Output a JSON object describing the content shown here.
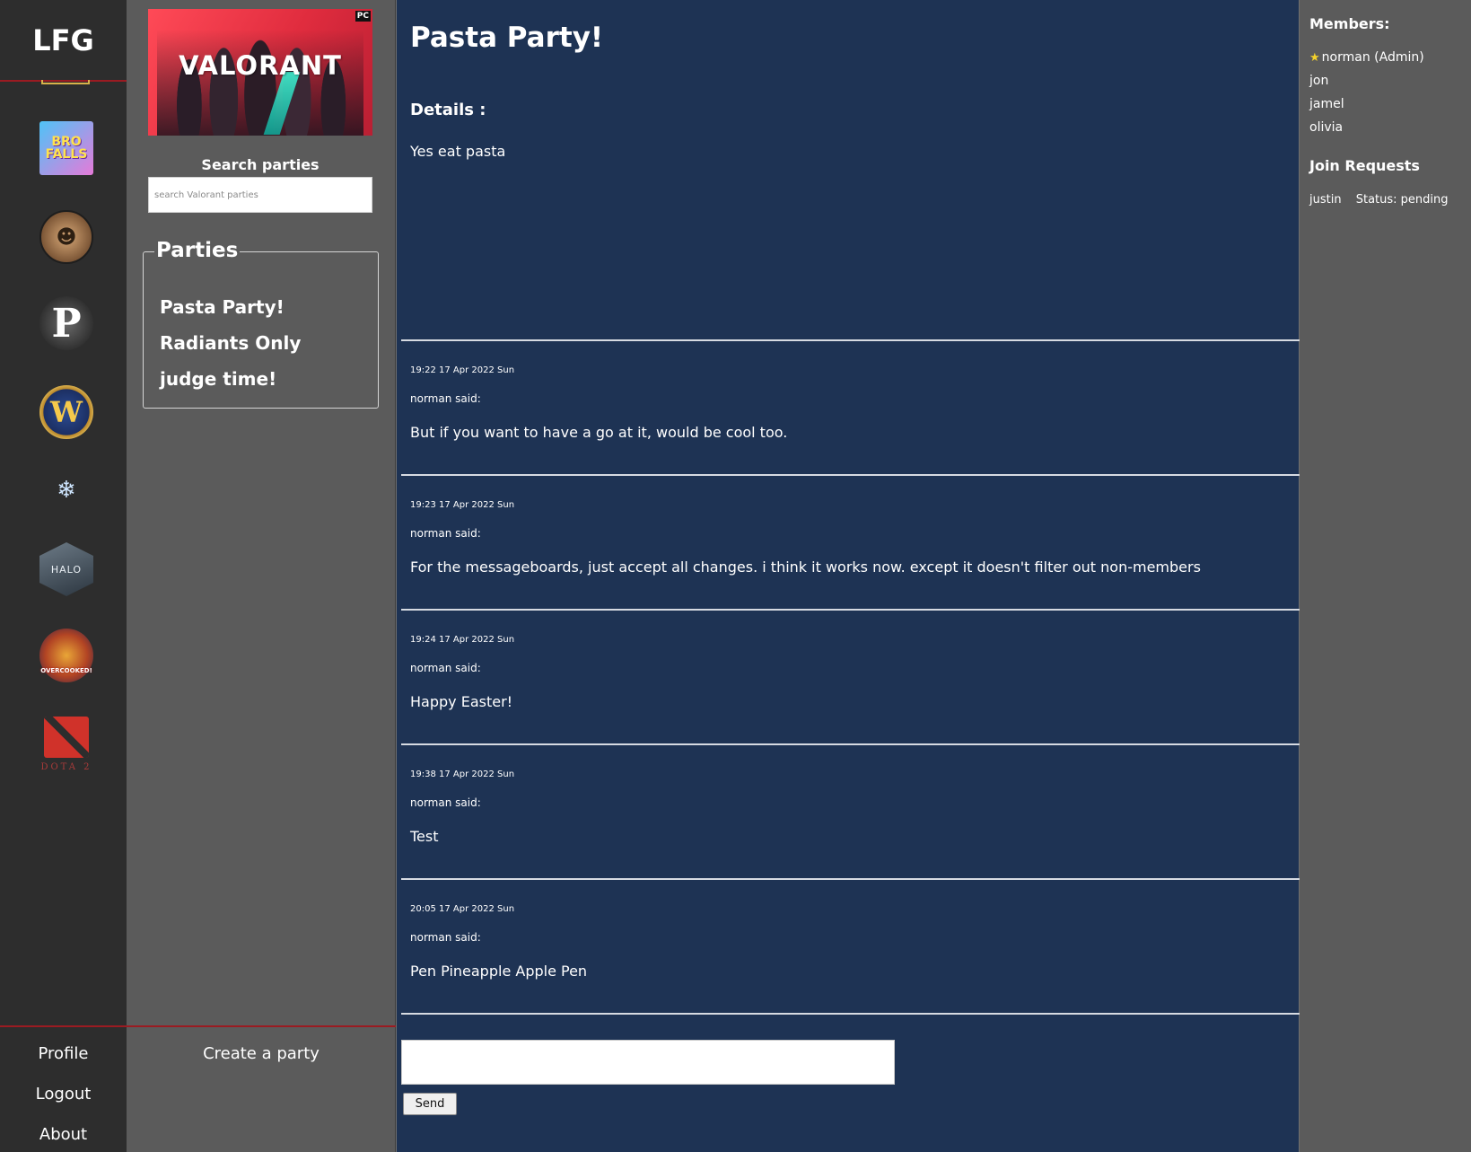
{
  "rail": {
    "logo": "LFG",
    "games": [
      {
        "name": "bro-falls",
        "label": "BRO FALLS"
      },
      {
        "name": "coin-game",
        "label": "☻"
      },
      {
        "name": "p-game",
        "label": "P"
      },
      {
        "name": "world-of-warcraft",
        "label": "W"
      },
      {
        "name": "final-fantasy-xiv",
        "label": "❄"
      },
      {
        "name": "halo",
        "label": "HALO"
      },
      {
        "name": "overcooked",
        "label": "OVERCOOKED!"
      },
      {
        "name": "dota-2",
        "label": "DOTA 2"
      }
    ],
    "profile": "Profile",
    "logout": "Logout",
    "about": "About"
  },
  "sidebar": {
    "banner_title": "VALORANT",
    "banner_platform": "PC",
    "search_label": "Search parties",
    "search_placeholder": "search Valorant parties",
    "parties_title": "Parties",
    "parties": [
      "Pasta Party!",
      "Radiants Only",
      "judge time!"
    ],
    "create_party": "Create a party"
  },
  "main": {
    "title": "Pasta Party!",
    "details_label": "Details :",
    "details_text": "Yes eat pasta",
    "messages": [
      {
        "time": "19:22 17 Apr 2022 Sun",
        "author": "norman said:",
        "text": "But if you want to have a go at it, would be cool too."
      },
      {
        "time": "19:23 17 Apr 2022 Sun",
        "author": "norman said:",
        "text": "For the messageboards, just accept all changes. i think it works now. except it doesn't filter out non-members"
      },
      {
        "time": "19:24 17 Apr 2022 Sun",
        "author": "norman said:",
        "text": "Happy Easter!"
      },
      {
        "time": "19:38 17 Apr 2022 Sun",
        "author": "norman said:",
        "text": "Test"
      },
      {
        "time": "20:05 17 Apr 2022 Sun",
        "author": "norman said:",
        "text": "Pen Pineapple Apple Pen"
      }
    ],
    "message_input_value": "",
    "send_label": "Send"
  },
  "members": {
    "title": "Members:",
    "admin_marker": "★",
    "list": [
      "norman (Admin)",
      "jon",
      "jamel",
      "olivia"
    ],
    "join_requests_title": "Join Requests",
    "join_requests": [
      {
        "name": "justin",
        "status": "Status: pending"
      }
    ]
  },
  "colors": {
    "rail_bg": "#2d2d2d",
    "sidebar_bg": "#5b5b5b",
    "main_bg": "#1e3354",
    "accent_red": "#9b1b22"
  }
}
